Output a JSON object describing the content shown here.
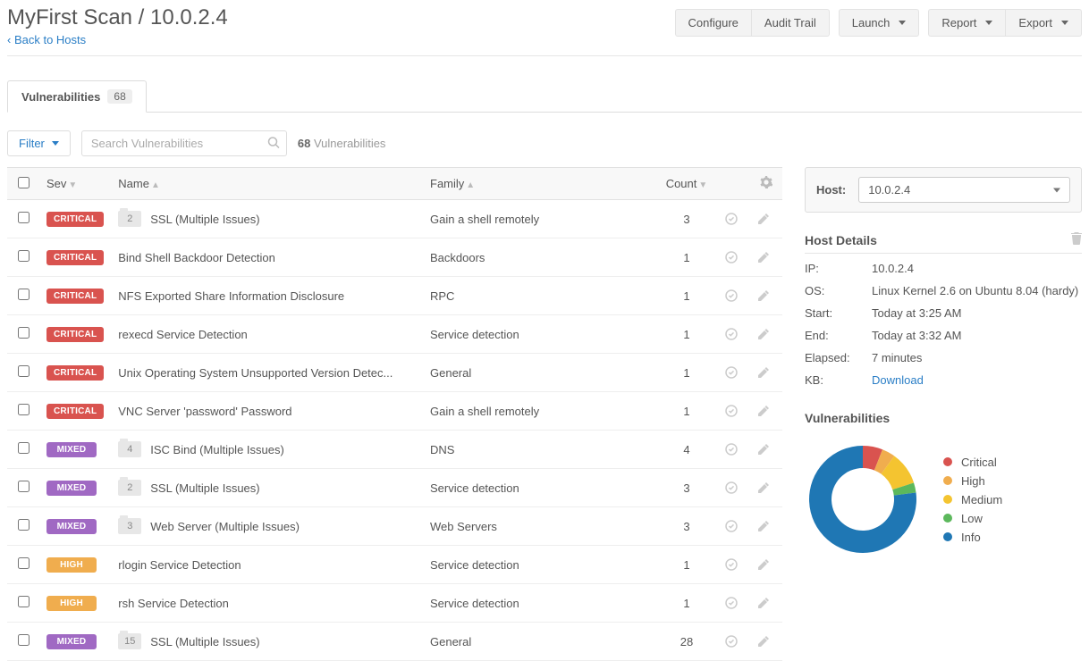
{
  "header": {
    "title": "MyFirst Scan / 10.0.2.4",
    "back_link": "Back to Hosts",
    "buttons": {
      "configure": "Configure",
      "audit_trail": "Audit Trail",
      "launch": "Launch",
      "report": "Report",
      "export": "Export"
    }
  },
  "tabs": {
    "vuln_label": "Vulnerabilities",
    "vuln_count": "68"
  },
  "filter": {
    "filter_label": "Filter",
    "search_placeholder": "Search Vulnerabilities",
    "count_value": "68",
    "count_label": "Vulnerabilities"
  },
  "columns": {
    "sev": "Sev",
    "name": "Name",
    "family": "Family",
    "count": "Count"
  },
  "rows": [
    {
      "sev": "CRITICAL",
      "folder": "2",
      "name": "SSL (Multiple Issues)",
      "family": "Gain a shell remotely",
      "count": "3"
    },
    {
      "sev": "CRITICAL",
      "name": "Bind Shell Backdoor Detection",
      "family": "Backdoors",
      "count": "1"
    },
    {
      "sev": "CRITICAL",
      "name": "NFS Exported Share Information Disclosure",
      "family": "RPC",
      "count": "1"
    },
    {
      "sev": "CRITICAL",
      "name": "rexecd Service Detection",
      "family": "Service detection",
      "count": "1"
    },
    {
      "sev": "CRITICAL",
      "name": "Unix Operating System Unsupported Version Detec...",
      "family": "General",
      "count": "1"
    },
    {
      "sev": "CRITICAL",
      "name": "VNC Server 'password' Password",
      "family": "Gain a shell remotely",
      "count": "1"
    },
    {
      "sev": "MIXED",
      "folder": "4",
      "name": "ISC Bind (Multiple Issues)",
      "family": "DNS",
      "count": "4"
    },
    {
      "sev": "MIXED",
      "folder": "2",
      "name": "SSL (Multiple Issues)",
      "family": "Service detection",
      "count": "3"
    },
    {
      "sev": "MIXED",
      "folder": "3",
      "name": "Web Server (Multiple Issues)",
      "family": "Web Servers",
      "count": "3"
    },
    {
      "sev": "HIGH",
      "name": "rlogin Service Detection",
      "family": "Service detection",
      "count": "1"
    },
    {
      "sev": "HIGH",
      "name": "rsh Service Detection",
      "family": "Service detection",
      "count": "1"
    },
    {
      "sev": "MIXED",
      "folder": "15",
      "name": "SSL (Multiple Issues)",
      "family": "General",
      "count": "28"
    }
  ],
  "host": {
    "label": "Host:",
    "selected": "10.0.2.4"
  },
  "host_details": {
    "title": "Host Details",
    "rows": [
      {
        "key": "IP:",
        "val": "10.0.2.4"
      },
      {
        "key": "OS:",
        "val": "Linux Kernel 2.6 on Ubuntu 8.04 (hardy)"
      },
      {
        "key": "Start:",
        "val": "Today at 3:25 AM"
      },
      {
        "key": "End:",
        "val": "Today at 3:32 AM"
      },
      {
        "key": "Elapsed:",
        "val": "7 minutes"
      },
      {
        "key": "KB:",
        "val": "Download",
        "link": true
      }
    ]
  },
  "vuln_summary": {
    "title": "Vulnerabilities",
    "legend": [
      {
        "label": "Critical",
        "color": "#d9534f"
      },
      {
        "label": "High",
        "color": "#f0ad4e"
      },
      {
        "label": "Medium",
        "color": "#f4c430"
      },
      {
        "label": "Low",
        "color": "#5cb85c"
      },
      {
        "label": "Info",
        "color": "#1f77b4"
      }
    ]
  },
  "chart_data": {
    "type": "pie",
    "title": "Vulnerabilities",
    "categories": [
      "Critical",
      "High",
      "Medium",
      "Low",
      "Info"
    ],
    "values": [
      6,
      4,
      10,
      3,
      77
    ],
    "colors": [
      "#d9534f",
      "#f0ad4e",
      "#f4c430",
      "#5cb85c",
      "#1f77b4"
    ]
  }
}
